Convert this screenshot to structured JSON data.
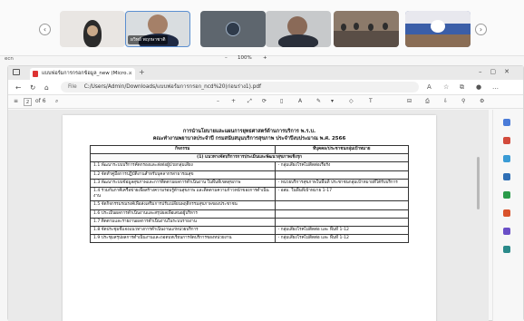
{
  "meeting": {
    "participants": [
      {
        "name": ""
      },
      {
        "name": "ผวิทย์ พฤกษาชาติ"
      },
      {
        "name": ""
      },
      {
        "name": ""
      },
      {
        "name": ""
      },
      {
        "name": ""
      }
    ],
    "nav_left": "‹",
    "nav_right": "›"
  },
  "zoom": {
    "edge_label": "ecn",
    "minus": "–",
    "value": "100%",
    "plus": "+"
  },
  "browser": {
    "tab_title": "แบบฟอร์มการกรอกข้อมูล_new (Micro…",
    "tab_close": "×",
    "new_tab": "+",
    "url_label": "File",
    "url": "C:/Users/Admin/Downloads/แบบฟอร์มการกรอก_ncd%20(ก่อนร่าง1).pdf",
    "page_current": "2",
    "page_total": "of 6"
  },
  "document": {
    "title_line1": "การนำนโยบายและแผนการยุทธศาสตร์ด้านการบริการ พ.ร.บ.",
    "title_line2": "คณะทำงานพยาบาลประจำปี กรมสนับสนุนบริการสุขภาพ ประจำปีงบประมาณ พ.ศ. 2566",
    "col_activity": "กิจกรรม",
    "col_target": "ที่บุคคล/ประชาชนกลุ่มเป้าหมาย",
    "group_heading": "(1) แนวทางจัดบริการการประเมินและพัฒนาสุขภาพเชิงรุก",
    "rows": [
      {
        "activity": "1.1 พัฒนาระบบบริการคัดกรองและส่งต่อผู้ป่วยกลุ่มเสี่ยง",
        "target": "- กลุ่มเสี่ยงโรคไม่ติดต่อเรื้อรัง"
      },
      {
        "activity": "1.2 จัดทำคู่มือการปฏิบัติงานสำหรับบุคลากรสาธารณสุข",
        "target": ""
      },
      {
        "activity": "1.3 พัฒนาระบบข้อมูลสุขภาพและการติดตามผลการดำเนินงาน ในพื้นที่เขตสุขภาพ",
        "target": "- หน่วยบริการสุขภาพในพื้นที่ ประชาชนกลุ่มเป้าหมายที่ได้รับบริการ"
      },
      {
        "activity": "1.4 ร่วมกับภาคีเครือข่ายเพื่อสร้างความรอบรู้ด้านสุขภาพ และติดตามความก้าวหน้าของการดำเนินงาน",
        "target": "- อสม. ในพื้นที่เป้าหมาย 1-17"
      },
      {
        "activity": "1.5 จัดกิจกรรมรณรงค์เพื่อส่งเสริมการปรับเปลี่ยนพฤติกรรมสุขภาพของประชาชน",
        "target": ""
      },
      {
        "activity": "1.6 ประเมินผลการดำเนินงานและสรุปผลเพื่อเสนอผู้บริหาร",
        "target": ""
      },
      {
        "activity": "1.7 ติดตามและรายงานผลการดำเนินงานในระบบรายงาน",
        "target": ""
      },
      {
        "activity": "1.8 จัดประชุมชี้แจงแนวทางการดำเนินงานแก่หน่วยบริการ",
        "target": "- กลุ่มเสี่ยงโรคไม่ติดต่อ และ พื้นที่ 1-12"
      },
      {
        "activity": "1.9 ประชุมสรุปผลการดำเนินงานและถอดบทเรียนการจัดบริการของหน่วยงาน",
        "target": "- กลุ่มเสี่ยงโรคไม่ติดต่อ และ พื้นที่ 1-12"
      }
    ]
  },
  "colors": {
    "accent": "#1a73e8",
    "sidebar_icons": [
      "#4a7bd8",
      "#d24a3c",
      "#3a9bd5",
      "#2f6fb5",
      "#2a9b4a",
      "#d9532c",
      "#6a4fc7",
      "#2a8a8a"
    ]
  }
}
